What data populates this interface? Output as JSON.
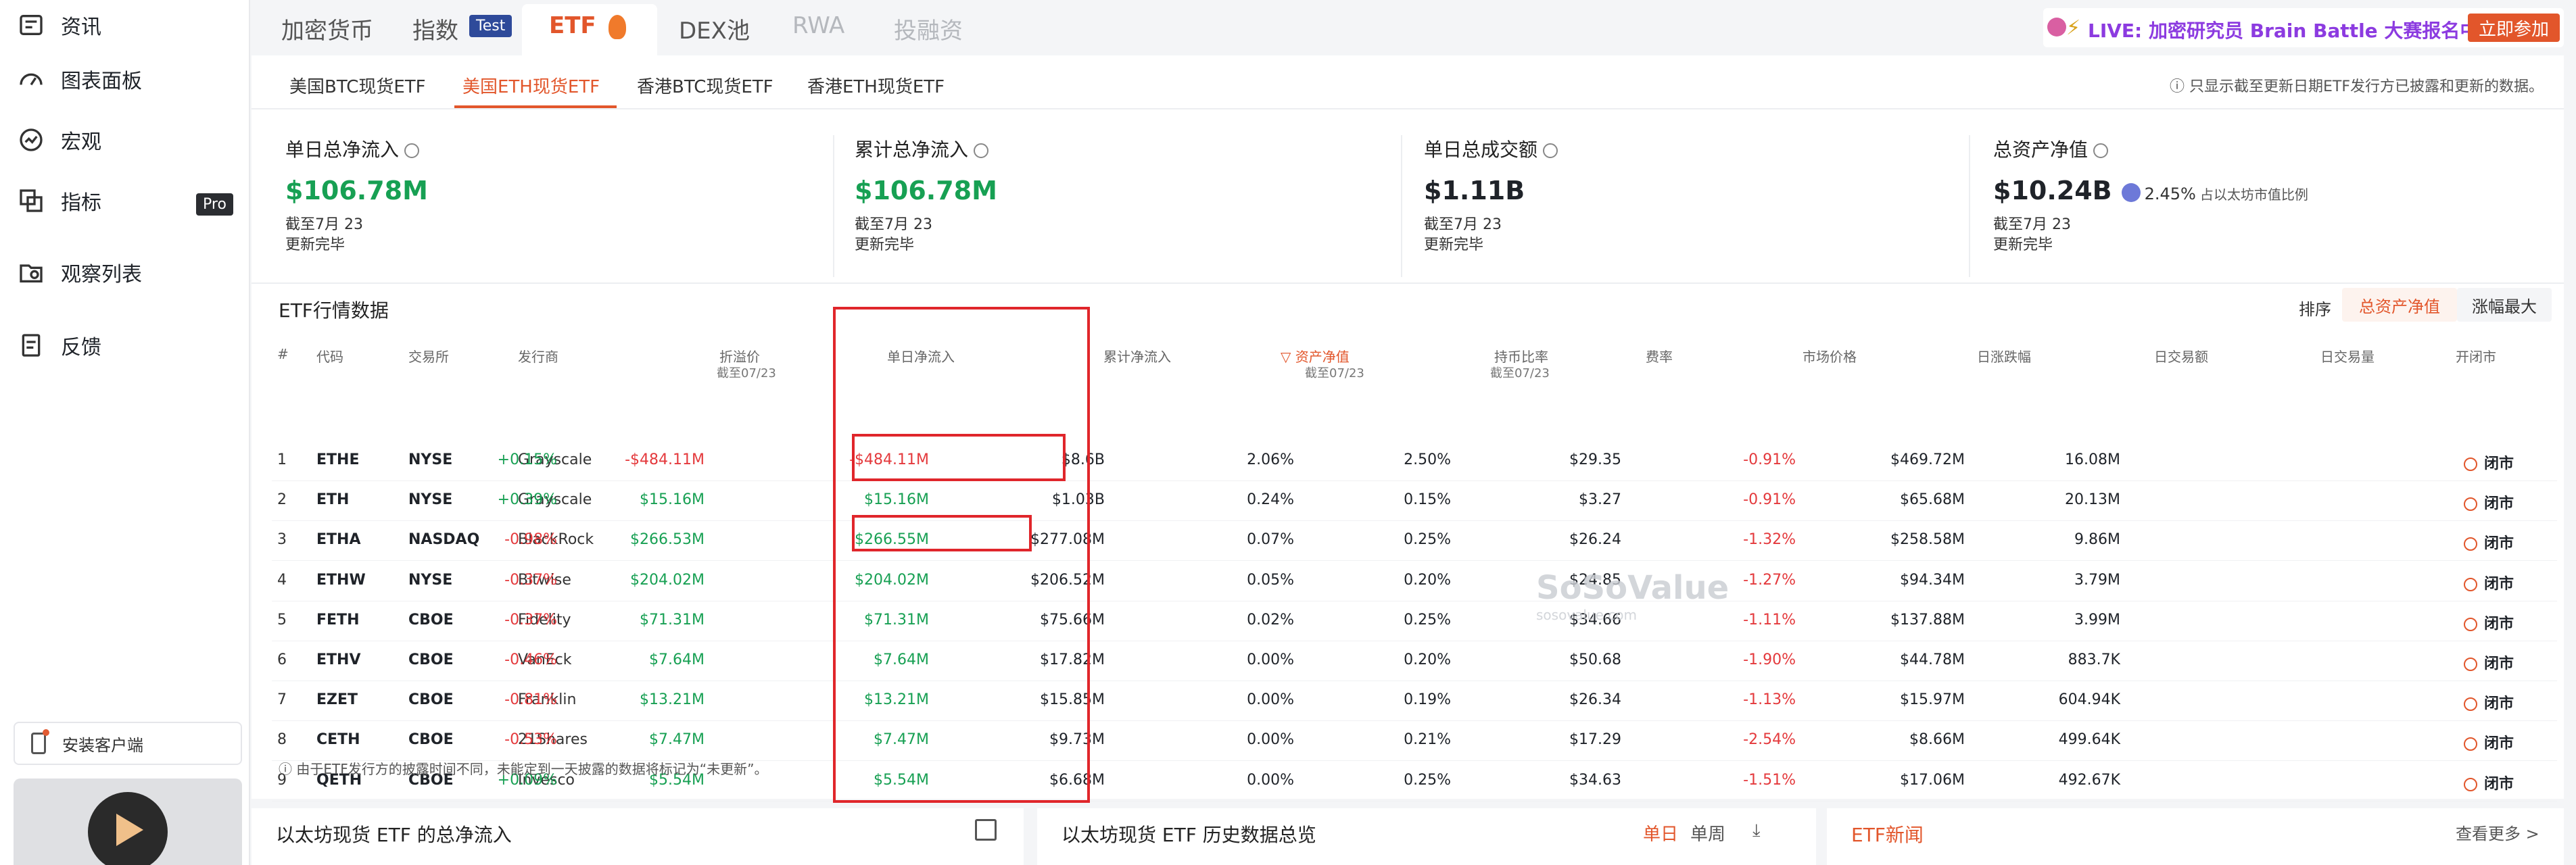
{
  "sidebar": {
    "items": [
      {
        "label": "资讯",
        "icon": "news-icon"
      },
      {
        "label": "图表面板",
        "icon": "dashboard-icon"
      },
      {
        "label": "宏观",
        "icon": "macro-icon"
      },
      {
        "label": "指标",
        "icon": "indicator-icon"
      },
      {
        "label": "观察列表",
        "icon": "watchlist-icon"
      },
      {
        "label": "反馈",
        "icon": "feedback-icon"
      }
    ],
    "pro_badge": "Pro",
    "app_download": "安装客户端"
  },
  "topnav": {
    "tabs": [
      "加密货币",
      "指数",
      "ETF",
      "DEX池",
      "RWA",
      "投融资"
    ],
    "test_badge": "Test",
    "live_banner": "LIVE: 加密研究员 Brain Battle 大赛报名中",
    "join_button": "立即参加"
  },
  "subtabs": [
    "美国BTC现货ETF",
    "美国ETH现货ETF",
    "香港BTC现货ETF",
    "香港ETH现货ETF"
  ],
  "notice": "只显示截至更新日期ETF发行方已披露和更新的数据。",
  "stats": [
    {
      "label": "单日总净流入",
      "value": "$106.78M",
      "as_of": "截至7月 23",
      "status": "更新完毕"
    },
    {
      "label": "累计总净流入",
      "value": "$106.78M",
      "as_of": "截至7月 23",
      "status": "更新完毕"
    },
    {
      "label": "单日总成交额",
      "value": "$1.11B",
      "as_of": "截至7月 23",
      "status": "更新完毕"
    },
    {
      "label": "总资产净值",
      "value": "$10.24B",
      "pct": "2.45%",
      "pct_note": "占以太坊市值比例",
      "as_of": "截至7月 23",
      "status": "更新完毕"
    }
  ],
  "table": {
    "title": "ETF行情数据",
    "sort_label": "排序",
    "sort_options": [
      "总资产净值",
      "涨幅最大"
    ],
    "headers": [
      "#",
      "代码",
      "交易所",
      "发行商",
      "折溢价",
      "单日净流入",
      "累计净流入",
      "资产净值",
      "持币比率",
      "费率",
      "市场价格",
      "日涨跌幅",
      "日交易额",
      "日交易量",
      "开闭市"
    ],
    "header_sub": {
      "premium": "截至07/23",
      "daily_inflow": "截至07/23",
      "net_assets": "截至07/23",
      "holdings": "截至07/23"
    },
    "rows": [
      {
        "n": "1",
        "ticker": "ETHE",
        "exchange": "NYSE",
        "issuer": "Grayscale",
        "premium": "+0.15%",
        "inflow": "-$484.11M",
        "cum": "-$484.11M",
        "assets": "$8.6B",
        "ratio": "2.06%",
        "fee": "2.50%",
        "price": "$29.35",
        "change": "-0.91%",
        "turnover": "$469.72M",
        "volume": "16.08M",
        "status": "闭市"
      },
      {
        "n": "2",
        "ticker": "ETH",
        "exchange": "NYSE",
        "issuer": "Grayscale",
        "premium": "+0.39%",
        "inflow": "$15.16M",
        "cum": "$15.16M",
        "assets": "$1.03B",
        "ratio": "0.24%",
        "fee": "0.15%",
        "price": "$3.27",
        "change": "-0.91%",
        "turnover": "$65.68M",
        "volume": "20.13M",
        "status": "闭市"
      },
      {
        "n": "3",
        "ticker": "ETHA",
        "exchange": "NASDAQ",
        "issuer": "BlackRock",
        "premium": "-0.98%",
        "inflow": "$266.53M",
        "cum": "$266.55M",
        "assets": "$277.08M",
        "ratio": "0.07%",
        "fee": "0.25%",
        "price": "$26.24",
        "change": "-1.32%",
        "turnover": "$258.58M",
        "volume": "9.86M",
        "status": "闭市"
      },
      {
        "n": "4",
        "ticker": "ETHW",
        "exchange": "NYSE",
        "issuer": "Bitwise",
        "premium": "-0.37%",
        "inflow": "$204.02M",
        "cum": "$204.02M",
        "assets": "$206.52M",
        "ratio": "0.05%",
        "fee": "0.20%",
        "price": "$24.85",
        "change": "-1.27%",
        "turnover": "$94.34M",
        "volume": "3.79M",
        "status": "闭市"
      },
      {
        "n": "5",
        "ticker": "FETH",
        "exchange": "CBOE",
        "issuer": "Fidelity",
        "premium": "-0.37%",
        "inflow": "$71.31M",
        "cum": "$71.31M",
        "assets": "$75.66M",
        "ratio": "0.02%",
        "fee": "0.25%",
        "price": "$34.66",
        "change": "-1.11%",
        "turnover": "$137.88M",
        "volume": "3.99M",
        "status": "闭市"
      },
      {
        "n": "6",
        "ticker": "ETHV",
        "exchange": "CBOE",
        "issuer": "VanEck",
        "premium": "-0.46%",
        "inflow": "$7.64M",
        "cum": "$7.64M",
        "assets": "$17.82M",
        "ratio": "0.00%",
        "fee": "0.20%",
        "price": "$50.68",
        "change": "-1.90%",
        "turnover": "$44.78M",
        "volume": "883.7K",
        "status": "闭市"
      },
      {
        "n": "7",
        "ticker": "EZET",
        "exchange": "CBOE",
        "issuer": "Franklin",
        "premium": "-0.81%",
        "inflow": "$13.21M",
        "cum": "$13.21M",
        "assets": "$15.85M",
        "ratio": "0.00%",
        "fee": "0.19%",
        "price": "$26.34",
        "change": "-1.13%",
        "turnover": "$15.97M",
        "volume": "604.94K",
        "status": "闭市"
      },
      {
        "n": "8",
        "ticker": "CETH",
        "exchange": "CBOE",
        "issuer": "21Shares",
        "premium": "-0.53%",
        "inflow": "$7.47M",
        "cum": "$7.47M",
        "assets": "$9.73M",
        "ratio": "0.00%",
        "fee": "0.21%",
        "price": "$17.29",
        "change": "-2.54%",
        "turnover": "$8.66M",
        "volume": "499.64K",
        "status": "闭市"
      },
      {
        "n": "9",
        "ticker": "QETH",
        "exchange": "CBOE",
        "issuer": "Invesco",
        "premium": "+0.09%",
        "inflow": "$5.54M",
        "cum": "$5.54M",
        "assets": "$6.68M",
        "ratio": "0.00%",
        "fee": "0.25%",
        "price": "$34.63",
        "change": "-1.51%",
        "turnover": "$17.06M",
        "volume": "492.67K",
        "status": "闭市"
      }
    ],
    "footnote": "由于ETF发行方的披露时间不同，未能定到一天披露的数据将标记为“未更新”。"
  },
  "watermark": {
    "brand": "SoSoValue",
    "url": "sosovalue.com"
  },
  "bottom": {
    "panel1_title": "以太坊现货 ETF 的总净流入",
    "panel2_title": "以太坊现货 ETF 历史数据总览",
    "panel2_tabs": [
      "单日",
      "单周"
    ],
    "panel3_title": "ETF新闻",
    "panel3_more": "查看更多 >"
  }
}
